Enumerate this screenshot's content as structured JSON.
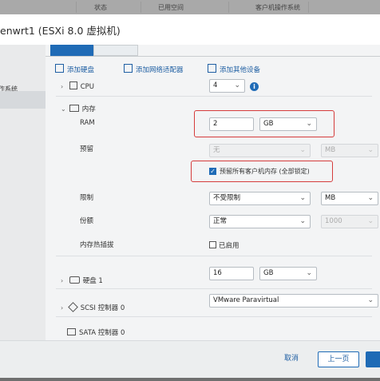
{
  "header_columns": [
    "状态",
    "已用空间",
    "客户机操作系统"
  ],
  "dialog": {
    "title": "enwrt1 (ESXi 8.0 虚拟机)",
    "left_items": [
      "操作系统"
    ]
  },
  "toolbar": {
    "add_disk": "添加硬盘",
    "add_network": "添加网络适配器",
    "add_device": "添加其他设备"
  },
  "hardware": {
    "cpu": {
      "label": "CPU",
      "value": "4"
    },
    "memory": {
      "label": "内存",
      "ram_label": "RAM",
      "ram_value": "2",
      "ram_unit": "GB",
      "reserve_label": "预留",
      "reserve_value": "无",
      "reserve_unit": "MB",
      "reserve_all_checkbox": "预留所有客户机内存 (全部锁定)",
      "limit_label": "限制",
      "limit_value": "不受限制",
      "limit_unit": "MB",
      "shares_label": "份额",
      "shares_value": "正常",
      "shares_number": "1000",
      "hotplug_label": "内存热插拔",
      "hotplug_checkbox": "已启用"
    },
    "disk": {
      "label": "硬盘 1",
      "value": "16",
      "unit": "GB"
    },
    "scsi": {
      "label": "SCSI 控制器 0",
      "value": "VMware Paravirtual"
    },
    "sata": {
      "label": "SATA 控制器 0"
    }
  },
  "footer": {
    "cancel": "取消",
    "back": "上一页"
  },
  "colors": {
    "accent": "#1f6bb6",
    "highlight_box": "#d53c3c"
  }
}
